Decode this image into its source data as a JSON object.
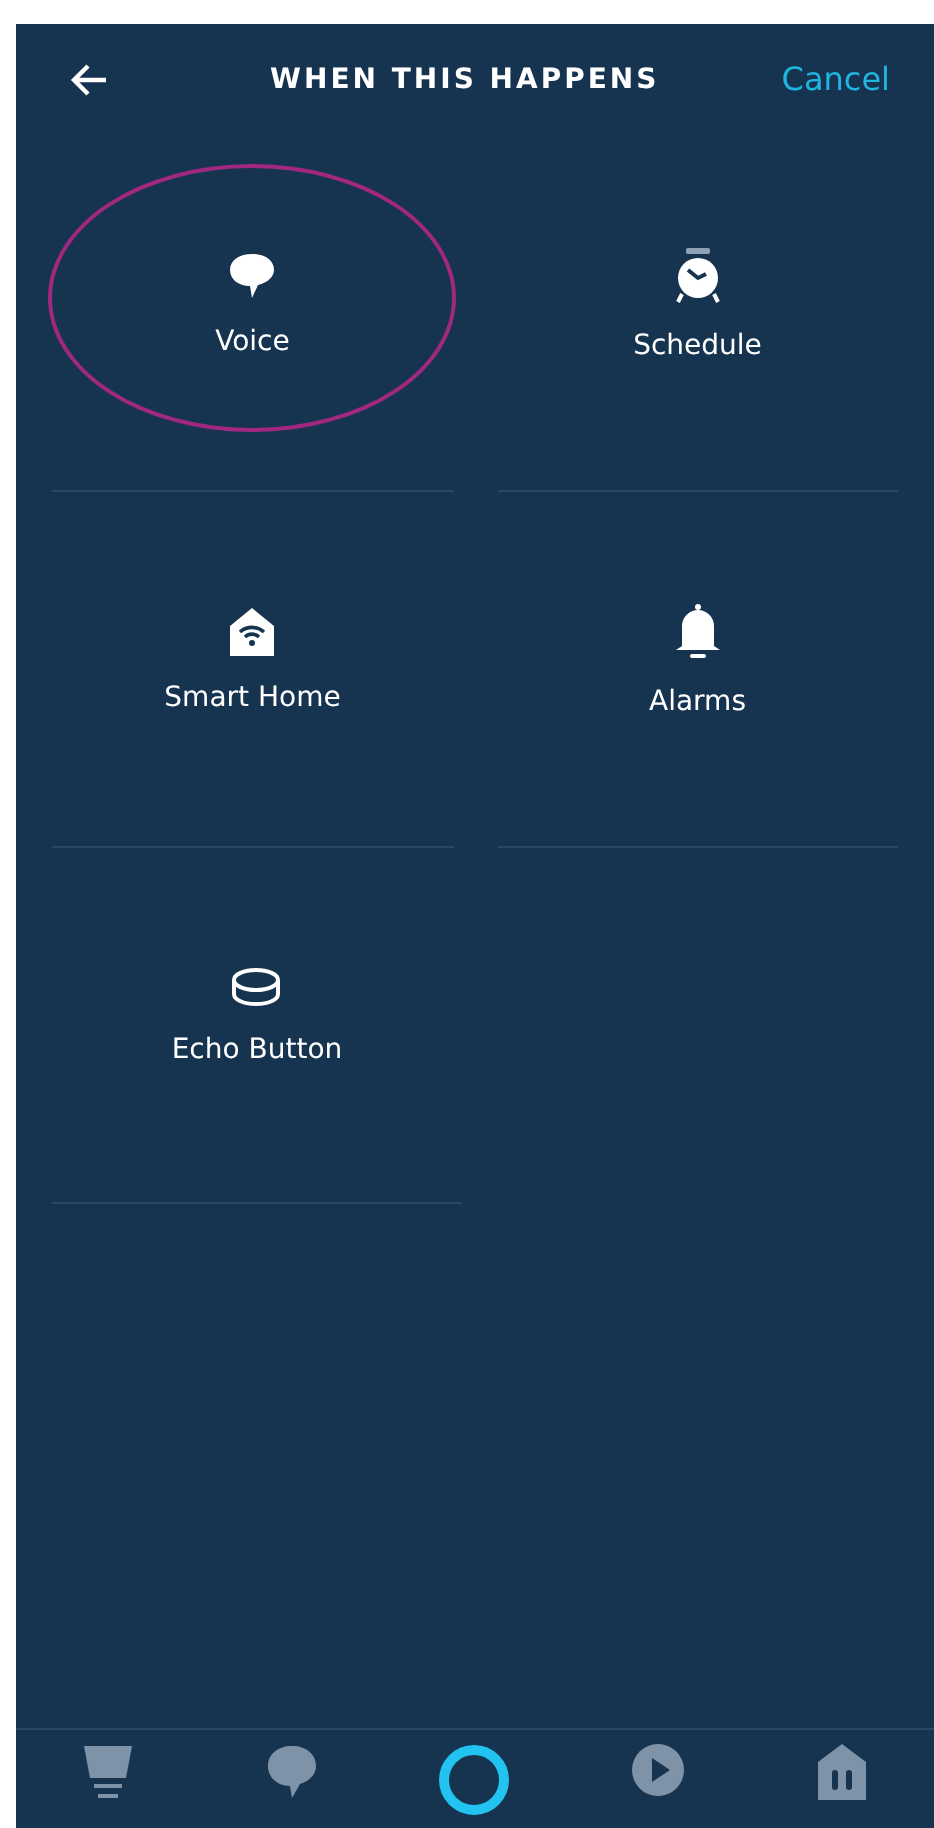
{
  "header": {
    "title": "WHEN THIS HAPPENS",
    "cancel": "Cancel"
  },
  "options": [
    {
      "kind": "voice",
      "label": "Voice",
      "highlighted": true
    },
    {
      "kind": "schedule",
      "label": "Schedule",
      "highlighted": false
    },
    {
      "kind": "smart-home",
      "label": "Smart Home",
      "highlighted": false
    },
    {
      "kind": "alarms",
      "label": "Alarms",
      "highlighted": false
    },
    {
      "kind": "echo-button",
      "label": "Echo Button",
      "highlighted": false
    }
  ],
  "nav": [
    {
      "kind": "home",
      "selected": false
    },
    {
      "kind": "communicate",
      "selected": false
    },
    {
      "kind": "alexa",
      "selected": true
    },
    {
      "kind": "play",
      "selected": false
    },
    {
      "kind": "devices",
      "selected": false
    }
  ]
}
